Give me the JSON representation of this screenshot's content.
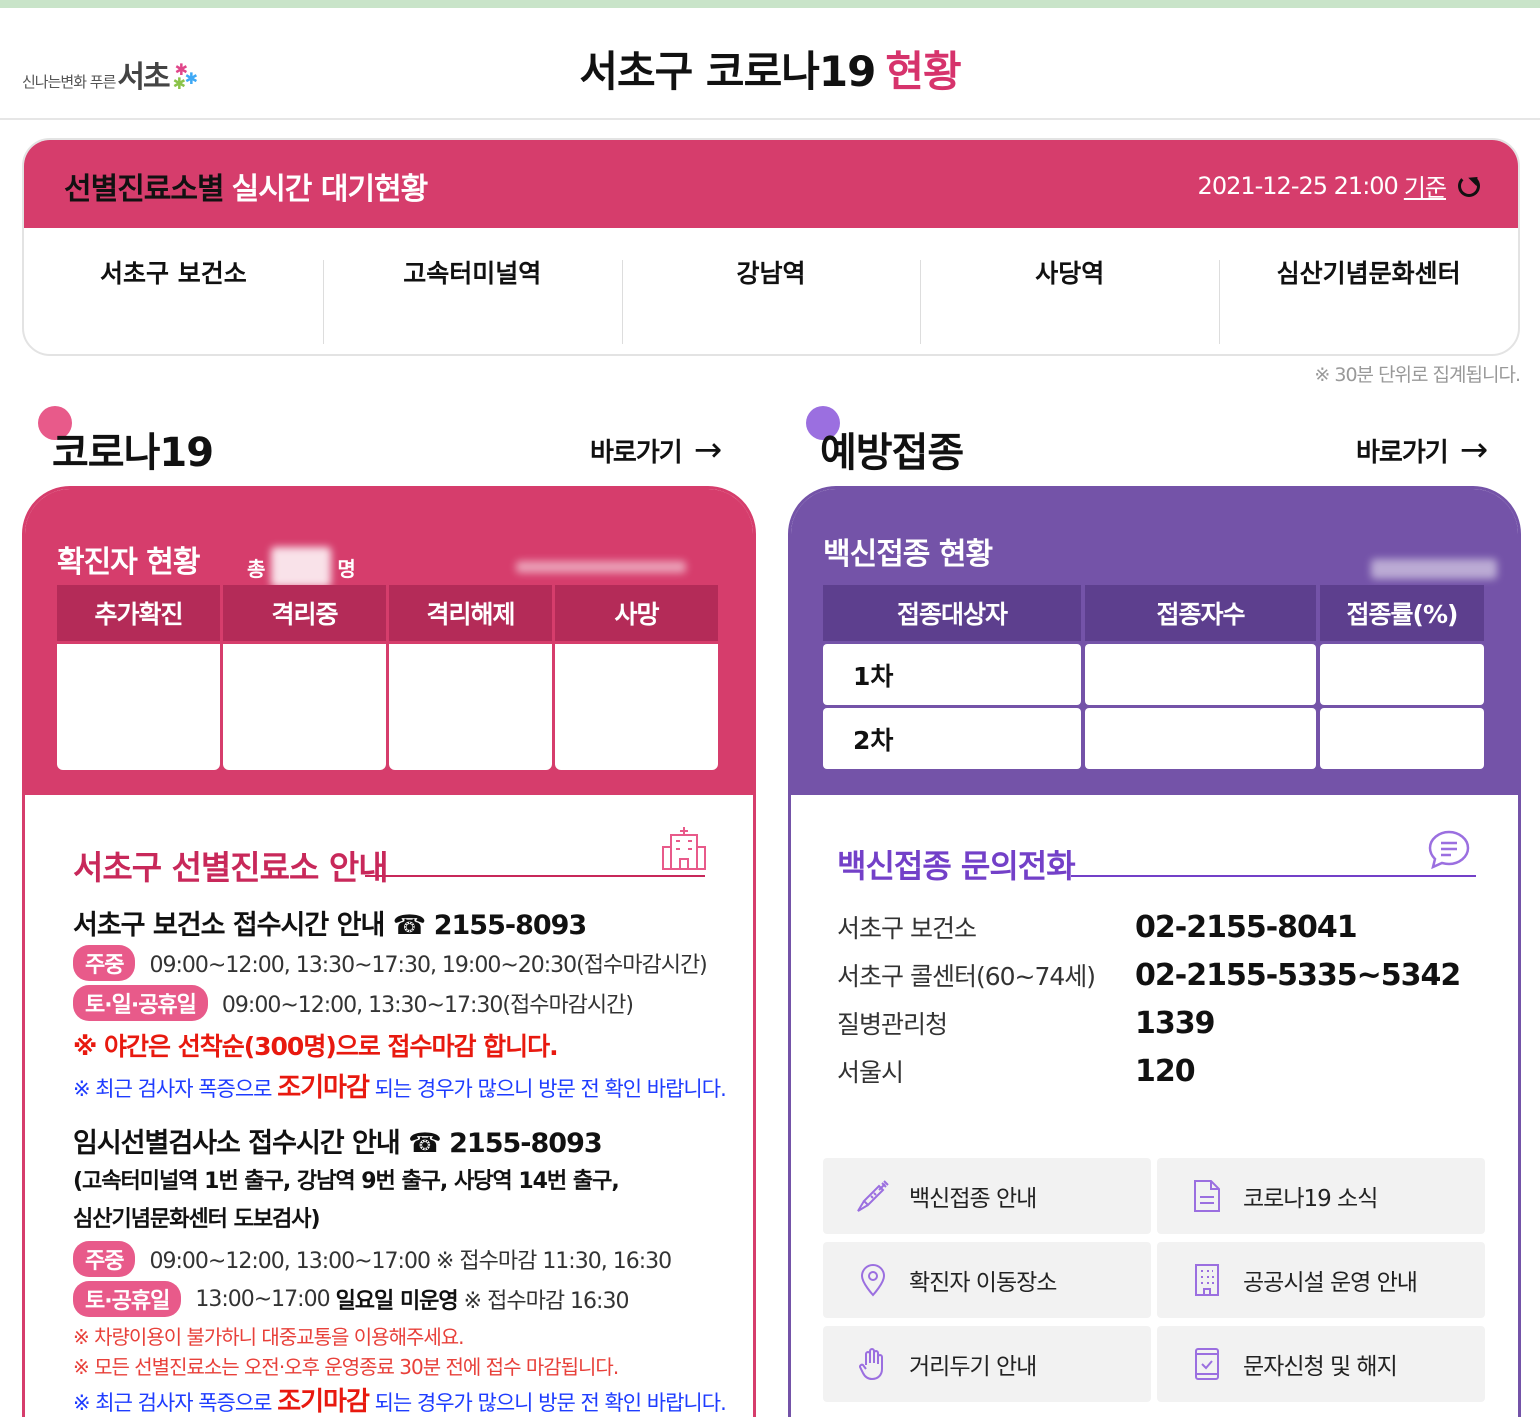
{
  "header": {
    "logo_small": "신나는변화 푸른",
    "logo_big": "서초",
    "title_main": "서초구 코로나19",
    "title_accent": "현황"
  },
  "wait": {
    "title_dark": "선별진료소별",
    "title_light": "실시간 대기현황",
    "timestamp": "2021-12-25 21:00",
    "basis": "기준",
    "sites": [
      "서초구 보건소",
      "고속터미널역",
      "강남역",
      "사당역",
      "심산기념문화센터"
    ],
    "note": "※ 30분 단위로 집계됩니다."
  },
  "corona": {
    "heading": "코로나19",
    "link": "바로가기",
    "stat_title": "확진자 현황",
    "total_prefix": "총",
    "total_suffix": "명",
    "columns": [
      "추가확진",
      "격리중",
      "격리해제",
      "사망"
    ],
    "guide_title": "서초구 선별진료소 안내",
    "center": {
      "title": "서초구 보건소 접수시간 안내 ☎ 2155-8093",
      "weekday_badge": "주중",
      "weekday_hours": "09:00~12:00, 13:30~17:30, 19:00~20:30(접수마감시간)",
      "weekend_badge": "토·일·공휴일",
      "weekend_hours": "09:00~12:00, 13:30~17:30(접수마감시간)",
      "night_notice": "※ 야간은 선착순(300명)으로 접수마감 합니다.",
      "early_prefix": "※ 최근 검사자 폭증으로",
      "early_em": "조기마감",
      "early_suffix": "되는 경우가 많으니 방문 전 확인 바랍니다."
    },
    "temp": {
      "title": "임시선별검사소 접수시간 안내 ☎ 2155-8093",
      "locations_1": "(고속터미널역 1번 출구, 강남역 9번 출구, 사당역 14번 출구,",
      "locations_2": "심산기념문화센터 도보검사)",
      "weekday_badge": "주중",
      "weekday_hours": "09:00~12:00, 13:00~17:00 ※ 접수마감 11:30, 16:30",
      "weekend_badge": "토·공휴일",
      "weekend_hours_a": "13:00~17:00",
      "weekend_hours_b": "일요일 미운영",
      "weekend_hours_c": "※ 접수마감 16:30",
      "note_1": "※ 차량이용이 불가하니 대중교통을 이용해주세요.",
      "note_2": "※ 모든 선별진료소는 오전·오후 운영종료 30분 전에 접수 마감됩니다.",
      "early_prefix": "※ 최근 검사자 폭증으로",
      "early_em": "조기마감",
      "early_suffix": "되는 경우가 많으니 방문 전 확인 바랍니다."
    }
  },
  "vaccine": {
    "heading": "예방접종",
    "link": "바로가기",
    "stat_title": "백신접종 현황",
    "columns": [
      "접종대상자",
      "접종자수",
      "접종률(%)"
    ],
    "rows": [
      "1차",
      "2차"
    ],
    "inquiry_title": "백신접종 문의전화",
    "contacts": [
      {
        "name": "서초구 보건소",
        "phone": "02-2155-8041"
      },
      {
        "name": "서초구 콜센터(60~74세)",
        "phone": "02-2155-5335~5342"
      },
      {
        "name": "질병관리청",
        "phone": "1339"
      },
      {
        "name": "서울시",
        "phone": "120"
      }
    ],
    "menu": [
      {
        "label": "백신접종 안내",
        "icon": "syringe-icon"
      },
      {
        "label": "코로나19 소식",
        "icon": "document-icon"
      },
      {
        "label": "확진자 이동장소",
        "icon": "location-pin-icon"
      },
      {
        "label": "공공시설 운영 안내",
        "icon": "building-icon"
      },
      {
        "label": "거리두기 안내",
        "icon": "hand-icon"
      },
      {
        "label": "문자신청 및 해지",
        "icon": "phone-check-icon"
      }
    ]
  },
  "colors": {
    "corona": "#d63d6c",
    "corona_dark": "#b42b58",
    "vaccine": "#7453a8",
    "vaccine_dark": "#5d3f8e",
    "link_highlight": "#27c8a6"
  }
}
